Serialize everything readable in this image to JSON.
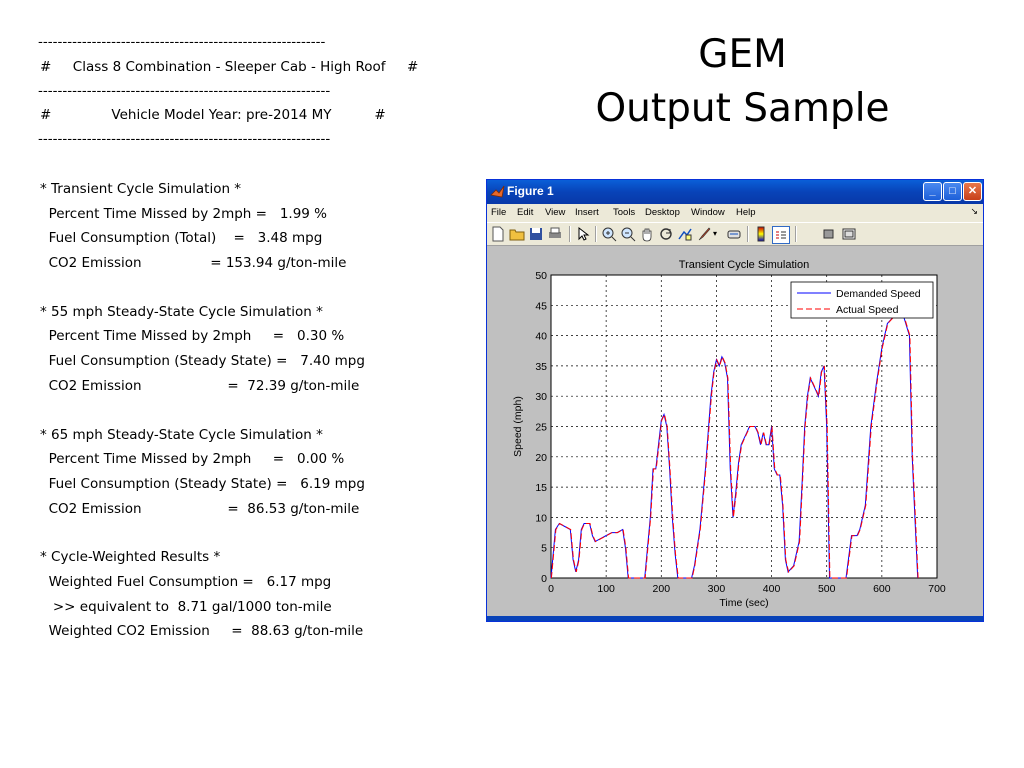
{
  "report": {
    "lines": [
      "-----------------------------------------------------------",
      "#     Class 8 Combination - Sleeper Cab - High Roof     #",
      "------------------------------------------------------------",
      "#              Vehicle Model Year: pre-2014 MY          #",
      "------------------------------------------------------------",
      "* Transient Cycle Simulation *",
      "  Percent Time Missed by 2mph =   1.99 %",
      "  Fuel Consumption (Total)    =   3.48 mpg",
      "  CO2 Emission                = 153.94 g/ton-mile",
      "* 55 mph Steady-State Cycle Simulation *",
      "  Percent Time Missed by 2mph     =   0.30 %",
      "  Fuel Consumption (Steady State) =   7.40 mpg",
      "  CO2 Emission                    =  72.39 g/ton-mile",
      "* 65 mph Steady-State Cycle Simulation *",
      "  Percent Time Missed by 2mph     =   0.00 %",
      "  Fuel Consumption (Steady State) =   6.19 mpg",
      "  CO2 Emission                    =  86.53 g/ton-mile",
      "* Cycle-Weighted Results *",
      "  Weighted Fuel Consumption =   6.17 mpg",
      "   >> equivalent to  8.71 gal/1000 ton-mile",
      "  Weighted CO2 Emission     =  88.63 g/ton-mile"
    ]
  },
  "slide": {
    "title_line1": "GEM",
    "title_line2": "Output Sample"
  },
  "window": {
    "title": "Figure 1",
    "menu": [
      "File",
      "Edit",
      "View",
      "Insert",
      "Tools",
      "Desktop",
      "Window",
      "Help"
    ],
    "toolbar_icons": [
      "new-file-icon",
      "open-folder-icon",
      "save-icon",
      "print-icon",
      "pointer-arrow-icon",
      "zoom-in-icon",
      "zoom-out-icon",
      "pan-hand-icon",
      "rotate-3d-icon",
      "data-cursor-icon",
      "brush-icon",
      "link-icon",
      "colorbar-icon",
      "legend-icon",
      "hide-plot-tools-icon",
      "show-plot-tools-icon"
    ],
    "buttons": {
      "minimize": "_",
      "maximize": "□",
      "close": "✕"
    }
  },
  "chart_data": {
    "type": "line",
    "title": "Transient Cycle Simulation",
    "xlabel": "Time (sec)",
    "ylabel": "Speed (mph)",
    "xlim": [
      0,
      700
    ],
    "ylim": [
      0,
      50
    ],
    "xticks": [
      "0",
      "100",
      "200",
      "300",
      "400",
      "500",
      "600",
      "700"
    ],
    "yticks": [
      "0",
      "5",
      "10",
      "15",
      "20",
      "25",
      "30",
      "35",
      "40",
      "45",
      "50"
    ],
    "grid": true,
    "legend_position": "top-right",
    "series": [
      {
        "name": "Demanded Speed",
        "color": "#0000ff",
        "style": "solid",
        "x": [
          0,
          8,
          15,
          25,
          35,
          40,
          45,
          50,
          55,
          60,
          70,
          75,
          80,
          90,
          100,
          110,
          120,
          130,
          135,
          140,
          145,
          170,
          175,
          180,
          185,
          190,
          195,
          200,
          205,
          210,
          215,
          220,
          225,
          230,
          235,
          245,
          255,
          260,
          270,
          280,
          290,
          295,
          300,
          305,
          310,
          315,
          320,
          325,
          330,
          335,
          340,
          345,
          350,
          355,
          360,
          370,
          375,
          380,
          385,
          390,
          395,
          400,
          405,
          410,
          415,
          420,
          425,
          430,
          440,
          450,
          455,
          460,
          465,
          470,
          480,
          485,
          490,
          495,
          500,
          505,
          510,
          520,
          535,
          545,
          555,
          560,
          570,
          580,
          590,
          600,
          605,
          610,
          620,
          630,
          640,
          650,
          655,
          660,
          665
        ],
        "y": [
          0,
          8,
          9,
          8.5,
          8,
          3,
          1,
          3,
          8,
          9,
          9,
          7,
          6,
          6.5,
          7,
          7.5,
          7.5,
          8,
          5,
          0,
          0,
          0,
          5,
          10,
          18,
          18,
          22,
          26,
          27,
          25,
          18,
          10,
          4,
          0,
          0,
          0,
          0,
          2,
          8,
          18,
          30,
          34,
          36,
          35,
          36.5,
          35.5,
          33,
          18,
          10,
          14,
          19,
          22,
          23,
          24,
          25,
          25,
          24,
          22,
          24,
          22,
          22,
          25,
          18,
          17,
          17,
          12,
          3,
          1,
          2,
          6,
          15,
          25,
          30,
          33,
          31,
          30,
          34,
          35,
          25,
          0,
          0,
          0,
          0,
          7,
          7,
          8,
          12,
          25,
          32,
          38,
          40,
          42,
          43,
          44,
          43,
          40,
          20,
          10,
          0
        ],
        "note_precision": "approximate"
      },
      {
        "name": "Actual Speed",
        "color": "#ff0000",
        "style": "dashed"
      }
    ]
  }
}
